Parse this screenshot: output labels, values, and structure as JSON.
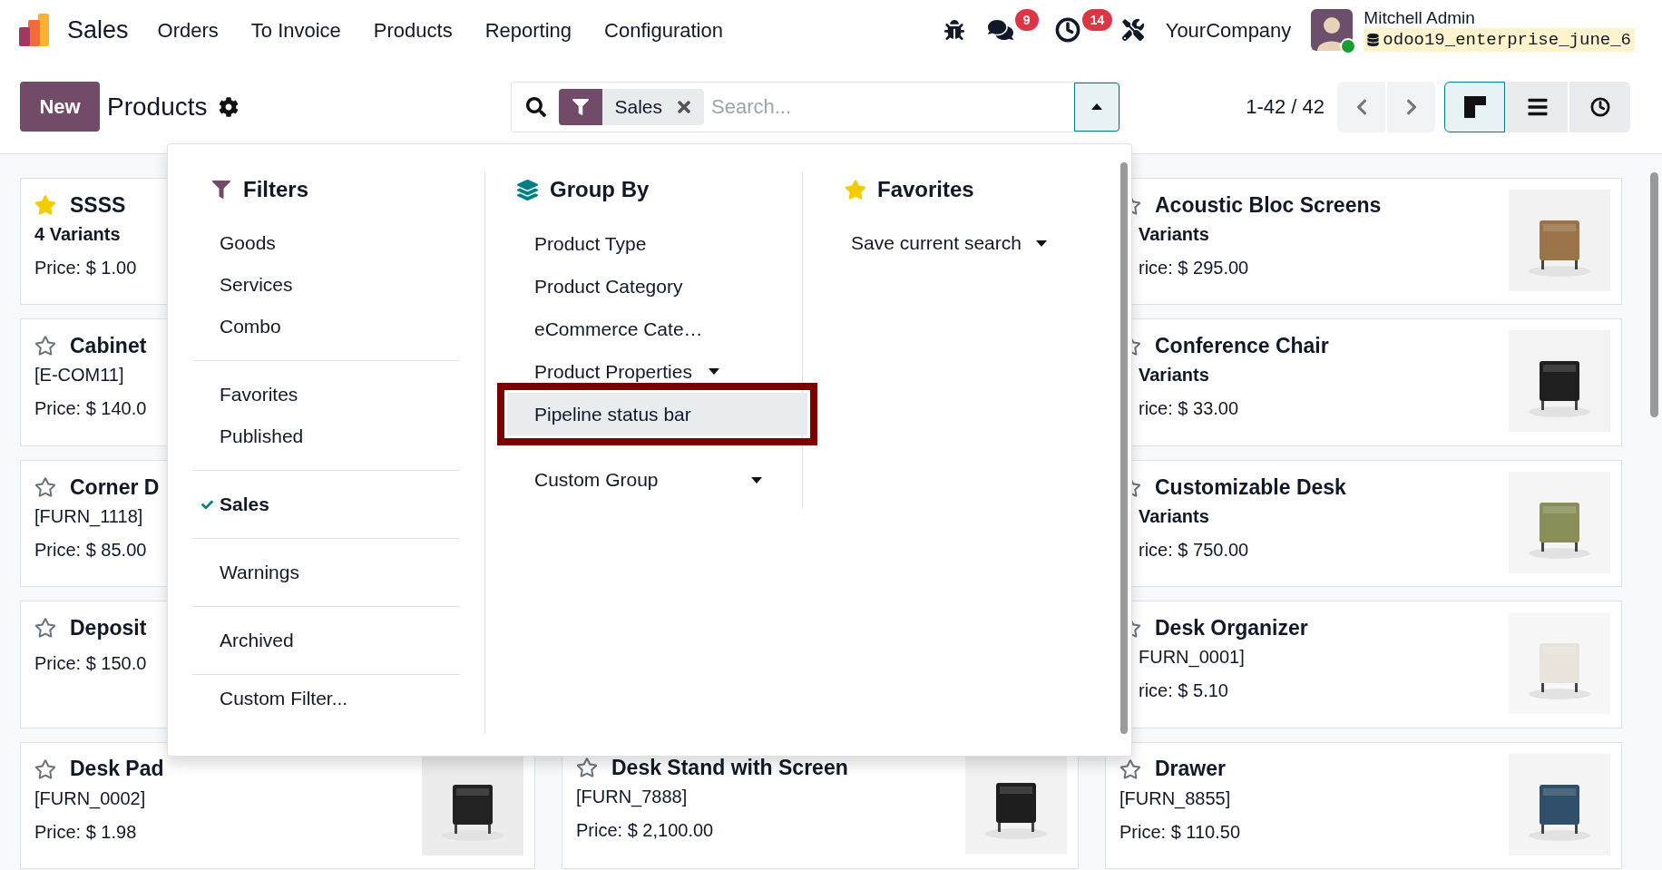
{
  "navbar": {
    "app": "Sales",
    "menus": [
      "Orders",
      "To Invoice",
      "Products",
      "Reporting",
      "Configuration"
    ],
    "systray": [
      {
        "kind": "bug"
      },
      {
        "kind": "chat",
        "badge": "9"
      },
      {
        "kind": "activity",
        "badge": "14"
      },
      {
        "kind": "tools"
      }
    ],
    "company": "YourCompany",
    "user": {
      "name": "Mitchell Admin",
      "database": "odoo19_enterprise_june_6",
      "online": true
    }
  },
  "control_panel": {
    "new_button": "New",
    "title": "Products",
    "search": {
      "facet": "Sales",
      "placeholder": "Search...",
      "expanded": true
    },
    "pager": "1-42 / 42",
    "views": [
      {
        "kind": "kanban",
        "selected": true
      },
      {
        "kind": "list",
        "selected": false
      },
      {
        "kind": "activity",
        "selected": false
      }
    ]
  },
  "search_panel": {
    "filters": {
      "title": "Filters",
      "groups": [
        [
          {
            "label": "Goods",
            "checked": false
          },
          {
            "label": "Services",
            "checked": false
          },
          {
            "label": "Combo",
            "checked": false
          }
        ],
        [
          {
            "label": "Favorites",
            "checked": false
          },
          {
            "label": "Published",
            "checked": false
          }
        ],
        [
          {
            "label": "Sales",
            "checked": true
          }
        ],
        [
          {
            "label": "Warnings",
            "checked": false
          }
        ],
        [
          {
            "label": "Archived",
            "checked": false
          }
        ]
      ],
      "custom_filter": "Custom Filter..."
    },
    "group_by": {
      "title": "Group By",
      "items": [
        {
          "label": "Product Type",
          "kind": "option",
          "highlighted": false,
          "annotated": false
        },
        {
          "label": "Product Category",
          "kind": "option",
          "highlighted": false,
          "annotated": false
        },
        {
          "label": "eCommerce Cate…",
          "kind": "option",
          "highlighted": false,
          "annotated": false
        },
        {
          "label": "Product Properties",
          "kind": "submenu",
          "highlighted": false,
          "annotated": false
        },
        {
          "label": "Pipeline status bar",
          "kind": "option",
          "highlighted": true,
          "annotated": true
        }
      ],
      "custom_group": "Custom Group"
    },
    "favorites": {
      "title": "Favorites",
      "save_search": "Save current search"
    }
  },
  "kanban": {
    "columns": [
      {
        "cards": [
          {
            "name": "SSSS",
            "favorite": true,
            "kind": "variants",
            "subtitle": "4 Variants",
            "price": "Price: $ 1.00"
          },
          {
            "name": "Cabinet",
            "favorite": false,
            "kind": "ref",
            "subtitle": "[E-COM11]",
            "price": "Price: $ 140.0"
          },
          {
            "name": "Corner D",
            "favorite": false,
            "kind": "ref",
            "subtitle": "[FURN_1118]",
            "price": "Price: $ 85.00"
          },
          {
            "name": "Deposit",
            "favorite": false,
            "price": "Price: $ 150.0"
          },
          {
            "name": "Desk Pad",
            "favorite": false,
            "kind": "ref",
            "subtitle": "[FURN_0002]",
            "price": "Price: $ 1.98",
            "image": true
          }
        ]
      },
      {
        "cards": [
          {
            "name": "Desk Stand with Screen",
            "favorite": false,
            "kind": "ref",
            "subtitle": "[FURN_7888]",
            "price": "Price: $ 2,100.00",
            "image": true
          }
        ]
      },
      {
        "cards": [
          {
            "name": "Acoustic Bloc Screens",
            "favorite": false,
            "kind": "variants",
            "subtitle": "Variants",
            "price": "rice: $ 295.00",
            "image": true
          },
          {
            "name": "Conference Chair",
            "favorite": false,
            "kind": "variants",
            "subtitle": "Variants",
            "price": "rice: $ 33.00",
            "image": true
          },
          {
            "name": "Customizable Desk",
            "favorite": false,
            "kind": "variants",
            "subtitle": "Variants",
            "price": "rice: $ 750.00",
            "image": true
          },
          {
            "name": "Desk Organizer",
            "favorite": false,
            "kind": "ref",
            "subtitle": "FURN_0001]",
            "price": "rice: $ 5.10",
            "image": true
          },
          {
            "name": "Drawer",
            "favorite": false,
            "kind": "ref",
            "subtitle": "[FURN_8855]",
            "price": "Price: $ 110.50",
            "image": true
          }
        ]
      }
    ]
  }
}
